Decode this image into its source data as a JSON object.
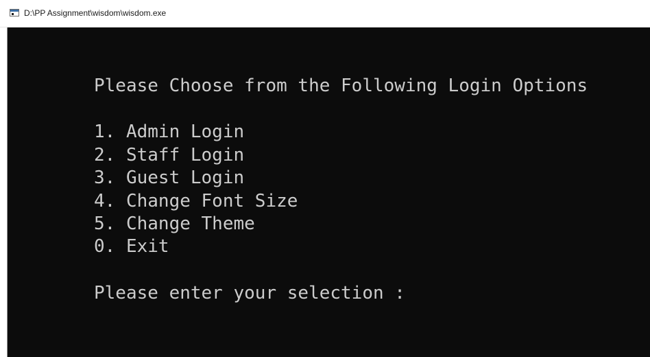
{
  "window": {
    "title": "D:\\PP Assignment\\wisdom\\wisdom.exe",
    "icon": "console-window-icon"
  },
  "console": {
    "heading": "Please Choose from the Following Login Options",
    "options": [
      "1. Admin Login",
      "2. Staff Login",
      "3. Guest Login",
      "4. Change Font Size",
      "5. Change Theme",
      "0. Exit"
    ],
    "prompt": "Please enter your selection :",
    "input_value": ""
  },
  "colors": {
    "console_background": "#0c0c0c",
    "console_text": "#cccccc",
    "titlebar_background": "#ffffff"
  }
}
